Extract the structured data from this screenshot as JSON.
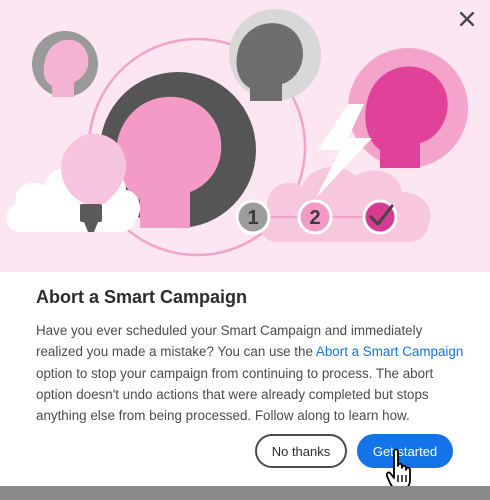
{
  "dialog": {
    "title": "Abort a Smart Campaign",
    "body_before_link": "Have you ever scheduled your Smart Campaign and immediately realized you made a mistake? You can use the ",
    "body_link": "Abort a Smart Campaign",
    "body_after_link": " option to stop your campaign from continuing to process. The abort option doesn't undo actions that were already completed but stops anything else from being processed. Follow along to learn how.",
    "secondary_button": "No thanks",
    "primary_button": "Get started"
  },
  "illustration": {
    "steps": [
      "1",
      "2"
    ]
  },
  "colors": {
    "hero_background": "#fce6f1",
    "primary": "#1473e6",
    "accent_pink": "#e0429a"
  }
}
